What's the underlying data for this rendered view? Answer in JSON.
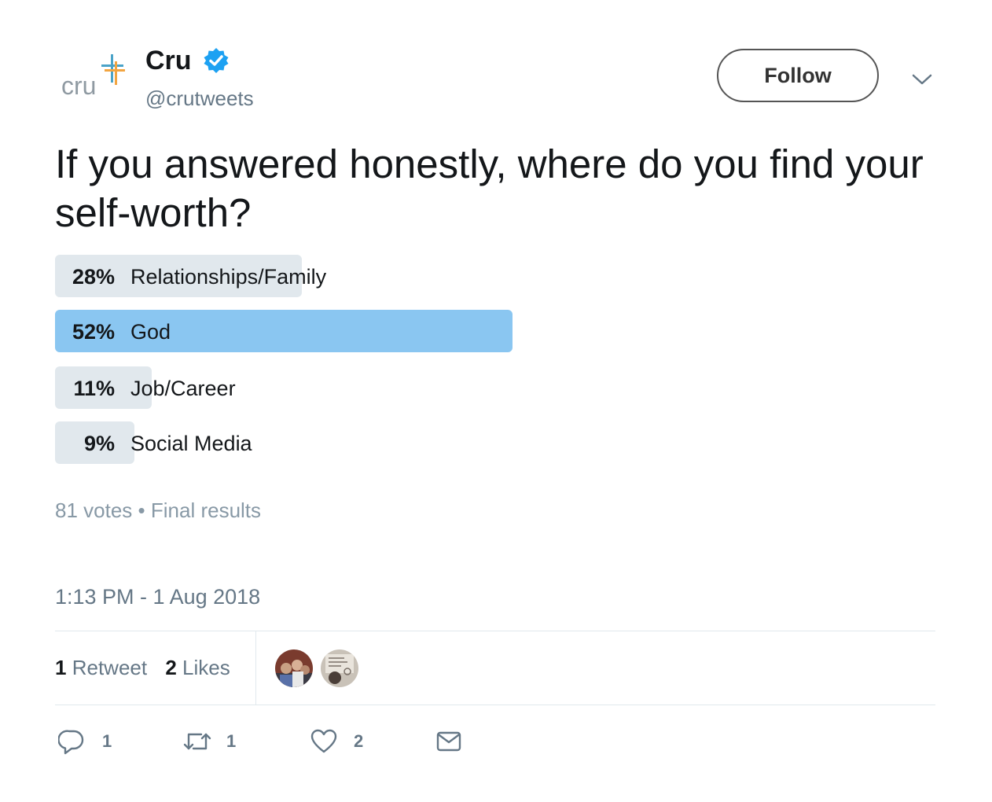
{
  "account": {
    "logo_text": "cru",
    "display_name": "Cru",
    "handle": "@crutweets",
    "verified": true
  },
  "header": {
    "follow_label": "Follow"
  },
  "tweet": {
    "text": "If you answered honestly, where do you find your self-worth?"
  },
  "poll": {
    "options": [
      {
        "percent_label": "28%",
        "percent": 28,
        "label": "Relationships/Family",
        "winner": false
      },
      {
        "percent_label": "52%",
        "percent": 52,
        "label": "God",
        "winner": true
      },
      {
        "percent_label": "11%",
        "percent": 11,
        "label": "Job/Career",
        "winner": false
      },
      {
        "percent_label": "9%",
        "percent": 9,
        "label": "Social Media",
        "winner": false
      }
    ],
    "votes": "81 votes",
    "separator": "•",
    "status": "Final results"
  },
  "timestamp": "1:13 PM - 1 Aug 2018",
  "stats": {
    "retweet_count": "1",
    "retweet_label": "Retweet",
    "like_count": "2",
    "like_label": "Likes"
  },
  "actions": {
    "reply_count": "1",
    "retweet_count": "1",
    "like_count": "2"
  },
  "colors": {
    "verified_blue": "#1da1f2",
    "poll_winner": "#8ac6f1",
    "poll_other": "#e1e8ed",
    "logo_blue": "#4aa3c8",
    "logo_orange": "#f2a541"
  },
  "icons": [
    "cru-logo",
    "verified-badge-icon",
    "chevron-down-icon",
    "reply-icon",
    "retweet-icon",
    "heart-icon",
    "message-icon"
  ]
}
